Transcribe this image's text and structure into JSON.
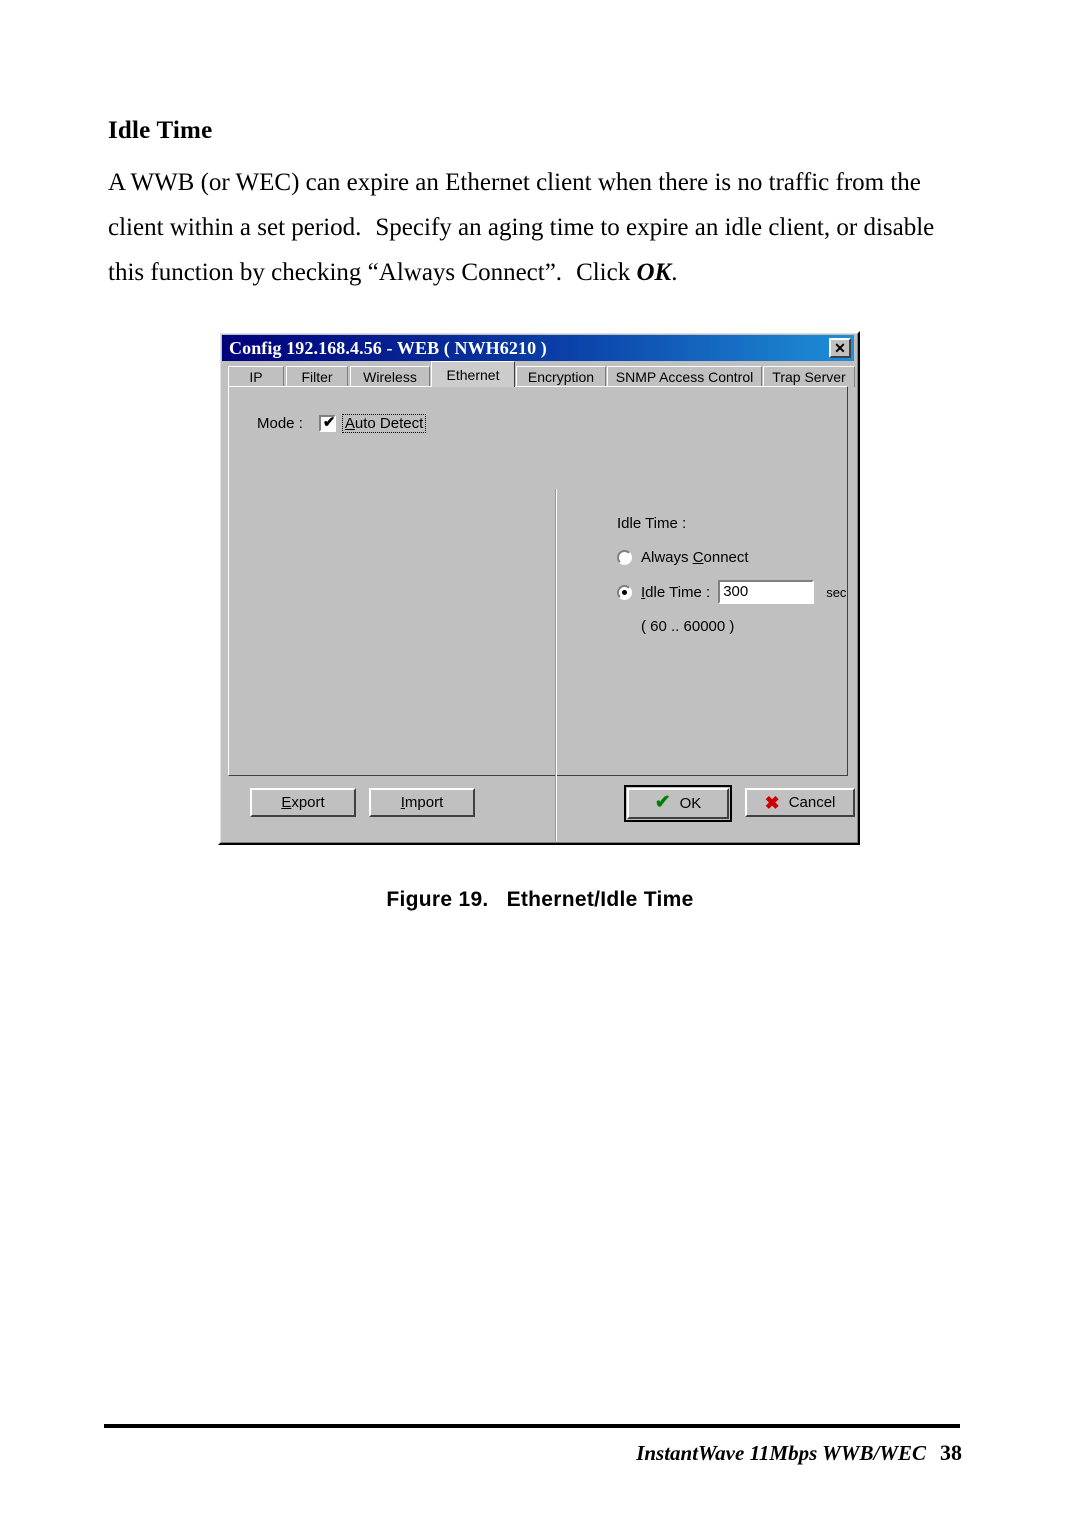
{
  "document": {
    "heading": "Idle Time",
    "paragraph_line1": "A WWB (or WEC) can expire an Ethernet client when there is no traffic from the",
    "paragraph_line2a": "client within a set period.",
    "paragraph_line2b": "Specify an aging time to expire an idle client, or",
    "paragraph_line3a": "disable this function by checking “Always Connect”.",
    "paragraph_line3b": "Click ",
    "paragraph_line3_em": "OK",
    "paragraph_line3c": ".",
    "figure_caption_number": "Figure 19.",
    "figure_caption_title": "Ethernet/Idle Time"
  },
  "footer": {
    "product": "InstantWave 11Mbps WWB/WEC",
    "page_number": "38"
  },
  "dialog": {
    "title": "Config 192.168.4.56 - WEB ( NWH6210 )",
    "close_icon": "close-icon",
    "close_glyph": "✕",
    "tabs": [
      {
        "label": "IP",
        "active": false
      },
      {
        "label": "Filter",
        "active": false
      },
      {
        "label": "Wireless",
        "active": false
      },
      {
        "label": "Ethernet",
        "active": true
      },
      {
        "label": "Encryption",
        "active": false
      },
      {
        "label": "SNMP Access Control",
        "active": false
      },
      {
        "label": "Trap Server",
        "active": false
      }
    ],
    "mode": {
      "label": "Mode :",
      "checkbox_checked": true,
      "checkbox_glyph": "✔",
      "option_accesskey": "A",
      "option_label_rest": "uto Detect"
    },
    "idle_time_group": {
      "title": "Idle Time :",
      "option_always_connect": {
        "selected": false,
        "text_before": "Always ",
        "accesskey": "C",
        "text_after": "onnect"
      },
      "option_idle_time": {
        "selected": true,
        "accesskey": "I",
        "text_after": "dle Time :",
        "value": "300",
        "unit": "sec"
      },
      "range_hint": "( 60 .. 60000 )"
    },
    "buttons": {
      "export": {
        "accesskey": "E",
        "rest": "xport"
      },
      "import": {
        "accesskey": "I",
        "rest": "mport"
      },
      "ok": {
        "label": "OK",
        "icon": "check-icon",
        "glyph": "✔",
        "default": true
      },
      "cancel": {
        "label": "Cancel",
        "icon": "cross-icon",
        "glyph": "✖"
      }
    }
  },
  "colors": {
    "titlebar_start": "#00007b",
    "titlebar_end": "#1f8fd8",
    "dialog_face": "#c0c0c0",
    "ok_check_green": "#008000",
    "cancel_x_red": "#cc0000"
  }
}
